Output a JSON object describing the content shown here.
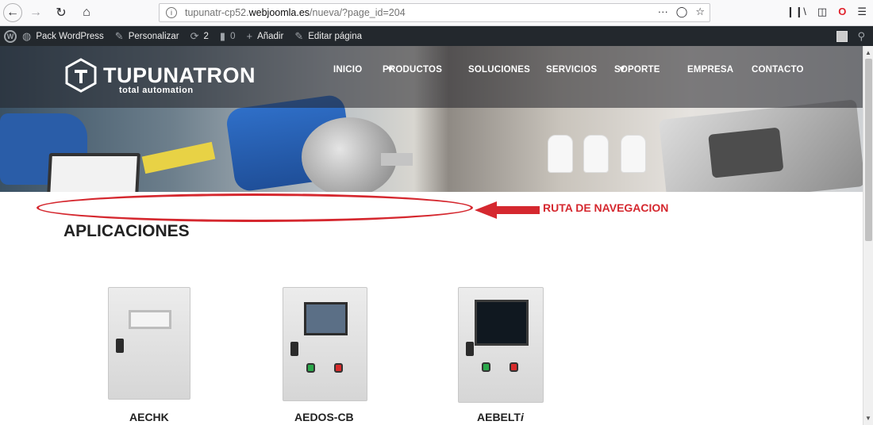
{
  "browser": {
    "url_prefix": "tupunatr-cp52.",
    "url_host": "webjoomla.es",
    "url_path": "/nueva/?page_id=204",
    "url_more": "···"
  },
  "wp_bar": {
    "site_name": "Pack WordPress",
    "customize": "Personalizar",
    "updates_count": "2",
    "comments_count": "0",
    "add_new": "Añadir",
    "edit_page": "Editar página"
  },
  "brand": {
    "name": "TUPUNATRON",
    "tagline": "total automation",
    "accent": "#d5282f"
  },
  "nav": {
    "items": [
      {
        "label": "INICIO"
      },
      {
        "label": "PRODUCTOS"
      },
      {
        "label": "SOLUCIONES"
      },
      {
        "label": "SERVICIOS"
      },
      {
        "label": "SOPORTE"
      },
      {
        "label": "EMPRESA"
      },
      {
        "label": "CONTACTO"
      }
    ]
  },
  "annotation": {
    "label": "RUTA DE NAVEGACION"
  },
  "page": {
    "title": "APLICACIONES"
  },
  "products": [
    {
      "name": "AECHK"
    },
    {
      "name": "AEDOS-CB"
    },
    {
      "name": "AEBELT",
      "suffix": "i"
    }
  ]
}
